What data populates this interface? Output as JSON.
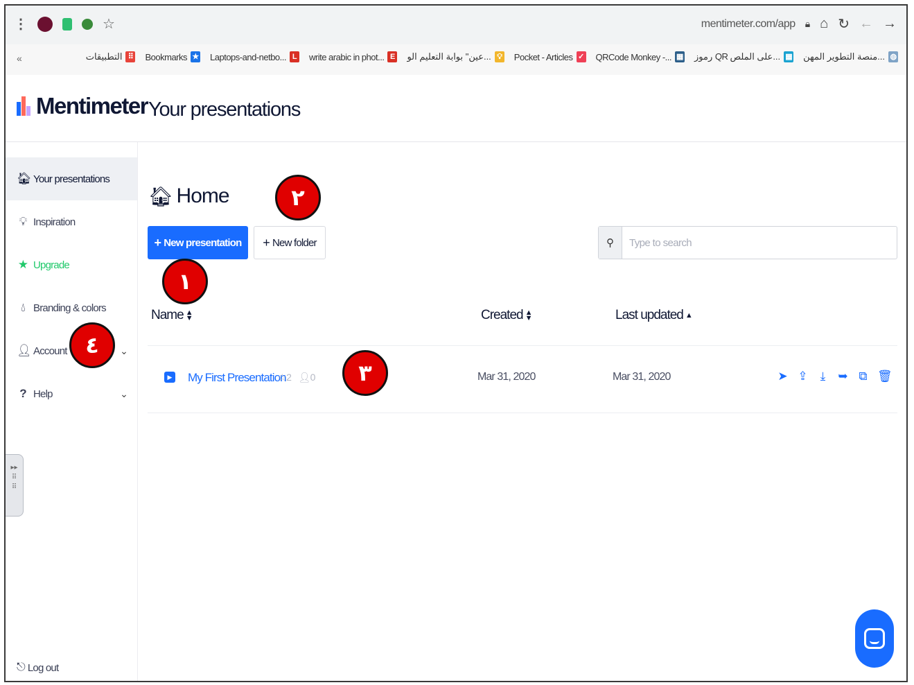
{
  "browser": {
    "url": "mentimeter.com/app"
  },
  "bookmarks": [
    {
      "label": "التطبيقات",
      "icon": "apps-grid-icon",
      "color": "#e8433a"
    },
    {
      "label": "Bookmarks",
      "icon": "star-icon",
      "color": "#1a73e8"
    },
    {
      "label": "Laptops-and-netbo...",
      "icon": "l-favicon",
      "color": "#d93025"
    },
    {
      "label": "write arabic in phot...",
      "icon": "e-favicon",
      "color": "#d93025"
    },
    {
      "label": "عين\" بوابة التعليم الو...",
      "icon": "bulb-favicon",
      "color": "#f2b62c"
    },
    {
      "label": "Pocket - Articles",
      "icon": "pocket-favicon",
      "color": "#ef4056"
    },
    {
      "label": "QRCode Monkey -...",
      "icon": "qr-favicon",
      "color": "#2d5f8a"
    },
    {
      "label": "رموز QR على الملص...",
      "icon": "qr-favicon",
      "color": "#1aa3d1"
    },
    {
      "label": "منصة التطوير المهن...",
      "icon": "globe-favicon",
      "color": "#7fa3c6"
    }
  ],
  "app": {
    "brand": "Mentimeter",
    "page_title": "Your presentations"
  },
  "sidebar": {
    "items": [
      {
        "label": "Your presentations"
      },
      {
        "label": "Inspiration"
      },
      {
        "label": "Upgrade"
      },
      {
        "label": "Branding & colors"
      },
      {
        "label": "Account"
      },
      {
        "label": "Help"
      }
    ],
    "logout": "Log out"
  },
  "main": {
    "heading": "Home",
    "new_presentation": "New presentation",
    "new_folder": "New folder",
    "search_placeholder": "Type to search",
    "columns": {
      "name": "Name",
      "created": "Created",
      "updated": "Last updated"
    },
    "rows": [
      {
        "name": "My First Presentation",
        "stars": "2",
        "users": "0",
        "created": "Mar 31, 2020",
        "updated": "Mar 31, 2020"
      }
    ]
  },
  "annotations": [
    "١",
    "٢",
    "٣",
    "٤"
  ],
  "colors": {
    "accent": "#196cff",
    "upgrade": "#21c96b",
    "badge": "#e00000"
  }
}
